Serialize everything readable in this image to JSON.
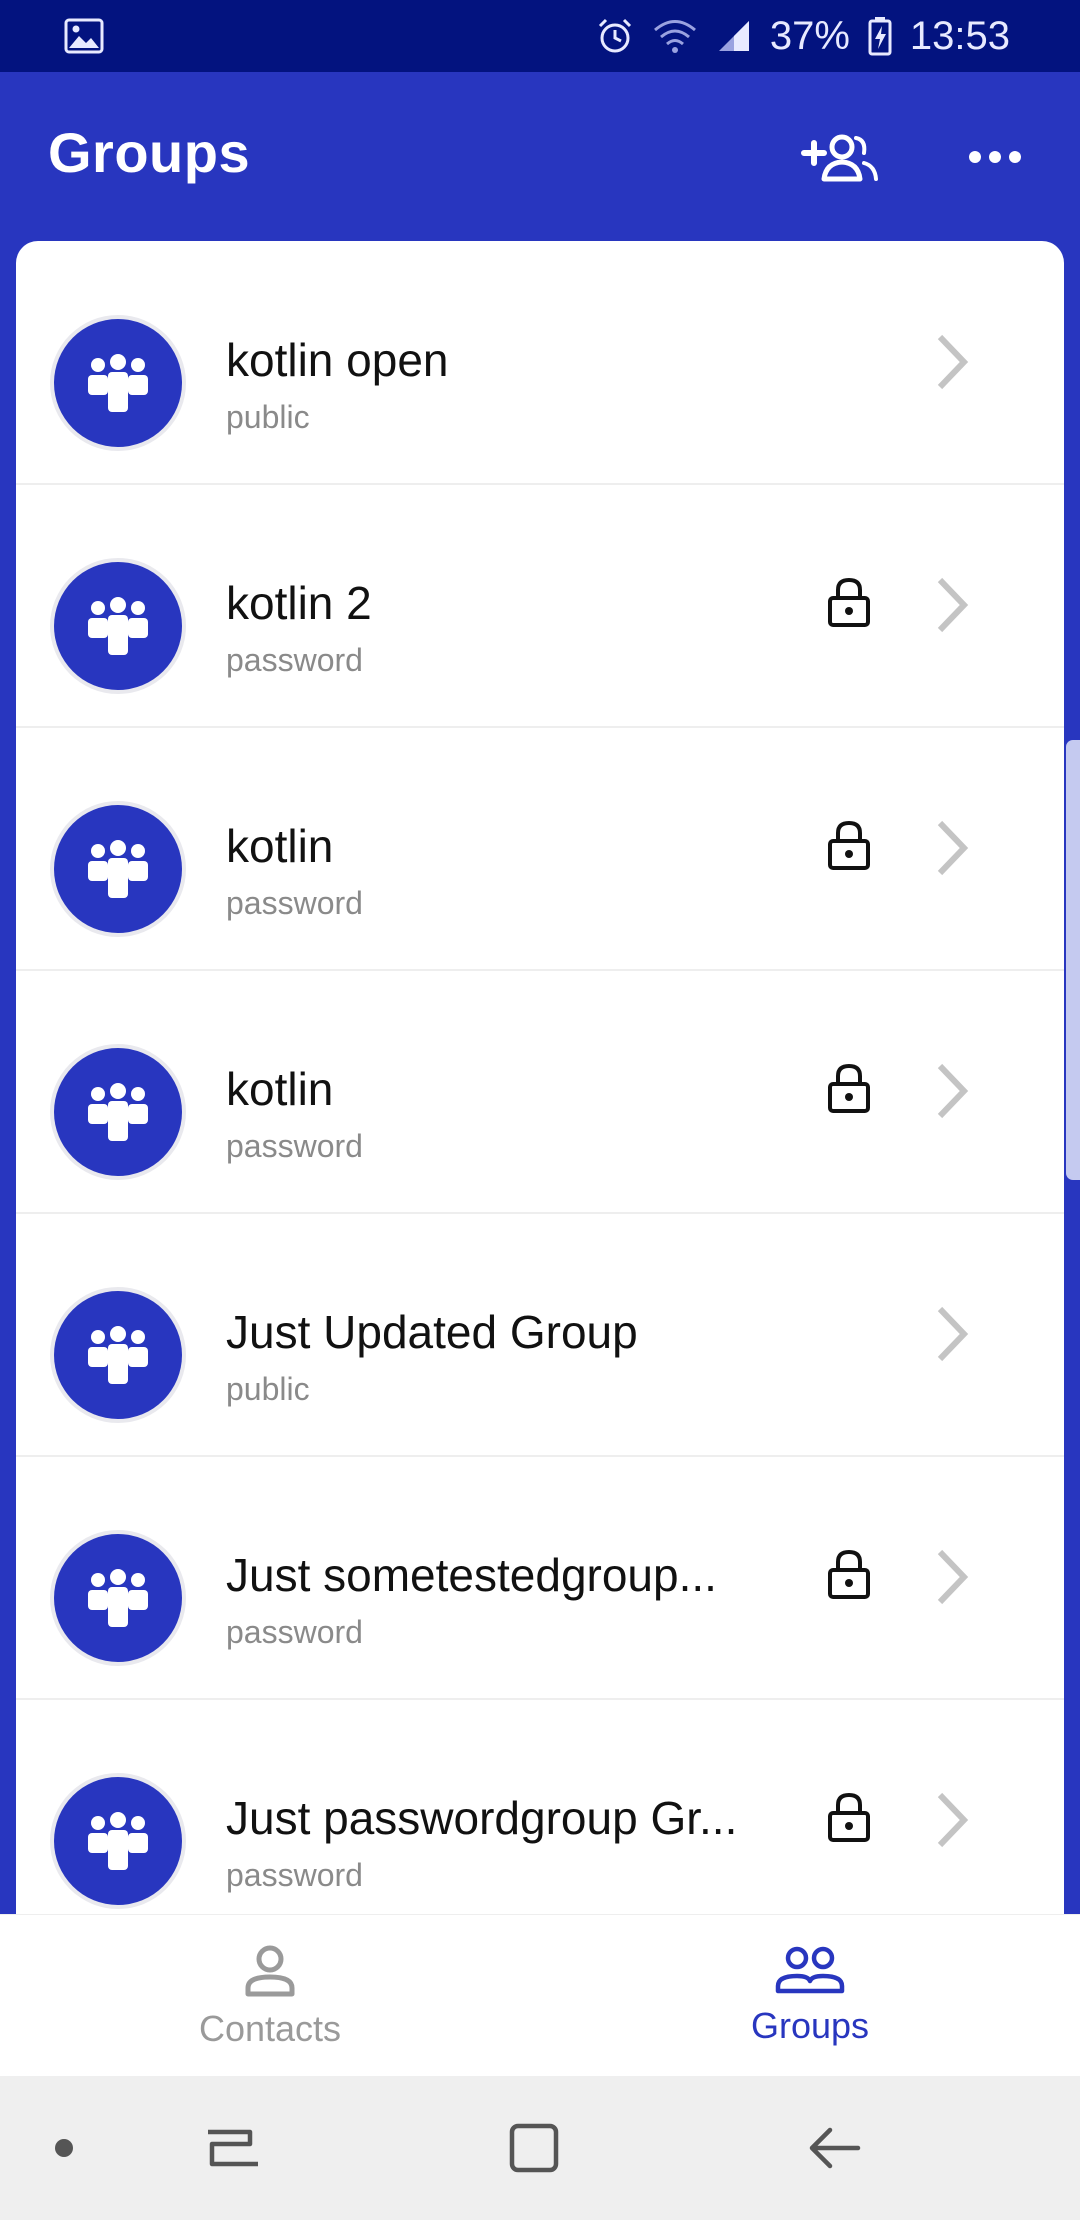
{
  "status_bar": {
    "battery_percent": "37%",
    "time": "13:53",
    "icons": [
      "gallery-icon",
      "alarm-icon",
      "wifi-icon",
      "signal-icon",
      "battery-charging-icon"
    ]
  },
  "app_bar": {
    "title": "Groups",
    "actions": [
      "add-group-icon",
      "more-options-icon"
    ]
  },
  "colors": {
    "primary": "#2836BF",
    "status_bar": "#03137F",
    "secondary_text": "#8a8a8a",
    "inactive_tab": "#9a9a9a"
  },
  "groups": [
    {
      "name": "kotlin open",
      "type": "public",
      "locked": false
    },
    {
      "name": "kotlin 2",
      "type": "password",
      "locked": true
    },
    {
      "name": "kotlin",
      "type": "password",
      "locked": true
    },
    {
      "name": "kotlin",
      "type": "password",
      "locked": true
    },
    {
      "name": "Just Updated Group",
      "type": "public",
      "locked": false
    },
    {
      "name": "Just sometestedgroup...",
      "type": "password",
      "locked": true
    },
    {
      "name": "Just passwordgroup Gr...",
      "type": "password",
      "locked": true
    }
  ],
  "bottom_nav": {
    "tabs": [
      {
        "label": "Contacts",
        "icon": "person-icon",
        "active": false
      },
      {
        "label": "Groups",
        "icon": "people-icon",
        "active": true
      }
    ]
  },
  "system_nav": [
    "dot-indicator",
    "recent-apps-icon",
    "home-icon",
    "back-icon"
  ]
}
